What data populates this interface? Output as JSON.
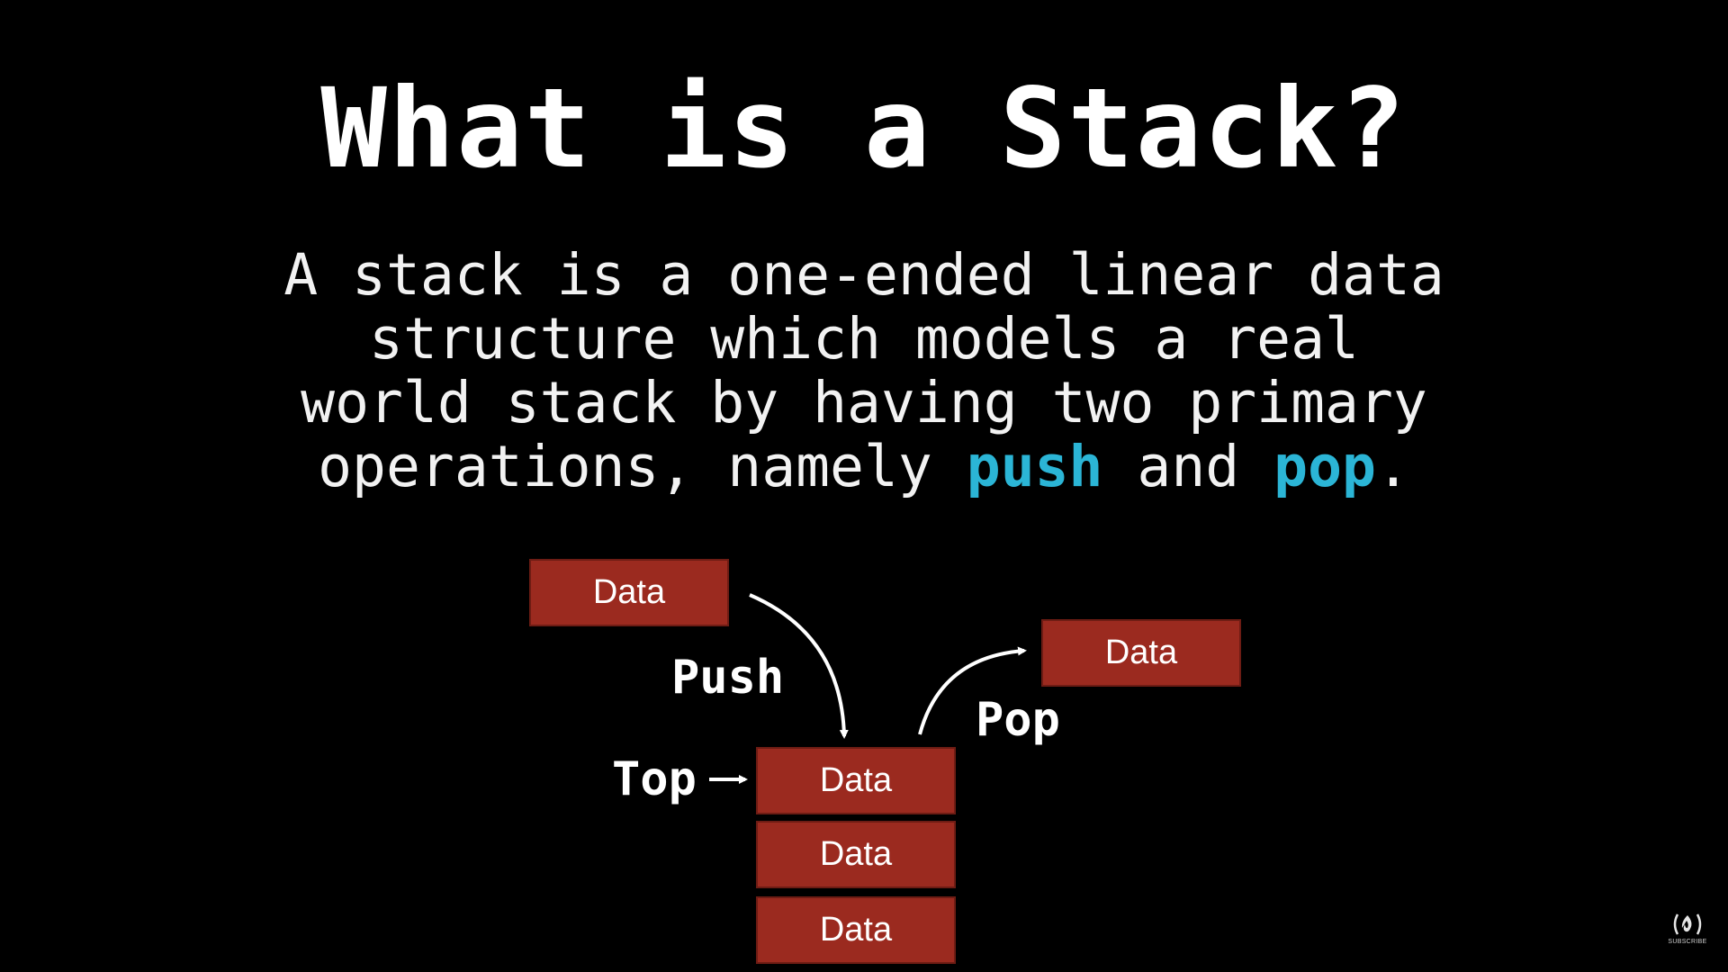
{
  "slide": {
    "title": "What is a Stack?",
    "description": {
      "line1": "A stack is a one-ended linear data",
      "line2": "structure which models a real",
      "line3_pre": "world stack by having two primary",
      "line4_pre": "operations, namely ",
      "push_word": "push",
      "and_word": " and ",
      "pop_word": "pop",
      "line4_end": "."
    },
    "keyword_color": "#2bb5d6"
  },
  "diagram": {
    "box_color": "#9b2a1f",
    "push_box": "Data",
    "popped_box": "Data",
    "stack_items": [
      "Data",
      "Data",
      "Data"
    ],
    "push_label": "Push",
    "pop_label": "Pop",
    "top_label": "Top"
  },
  "channel_logo": {
    "icon": "freecodecamp-logo-icon",
    "caption": "SUBSCRIBE"
  }
}
